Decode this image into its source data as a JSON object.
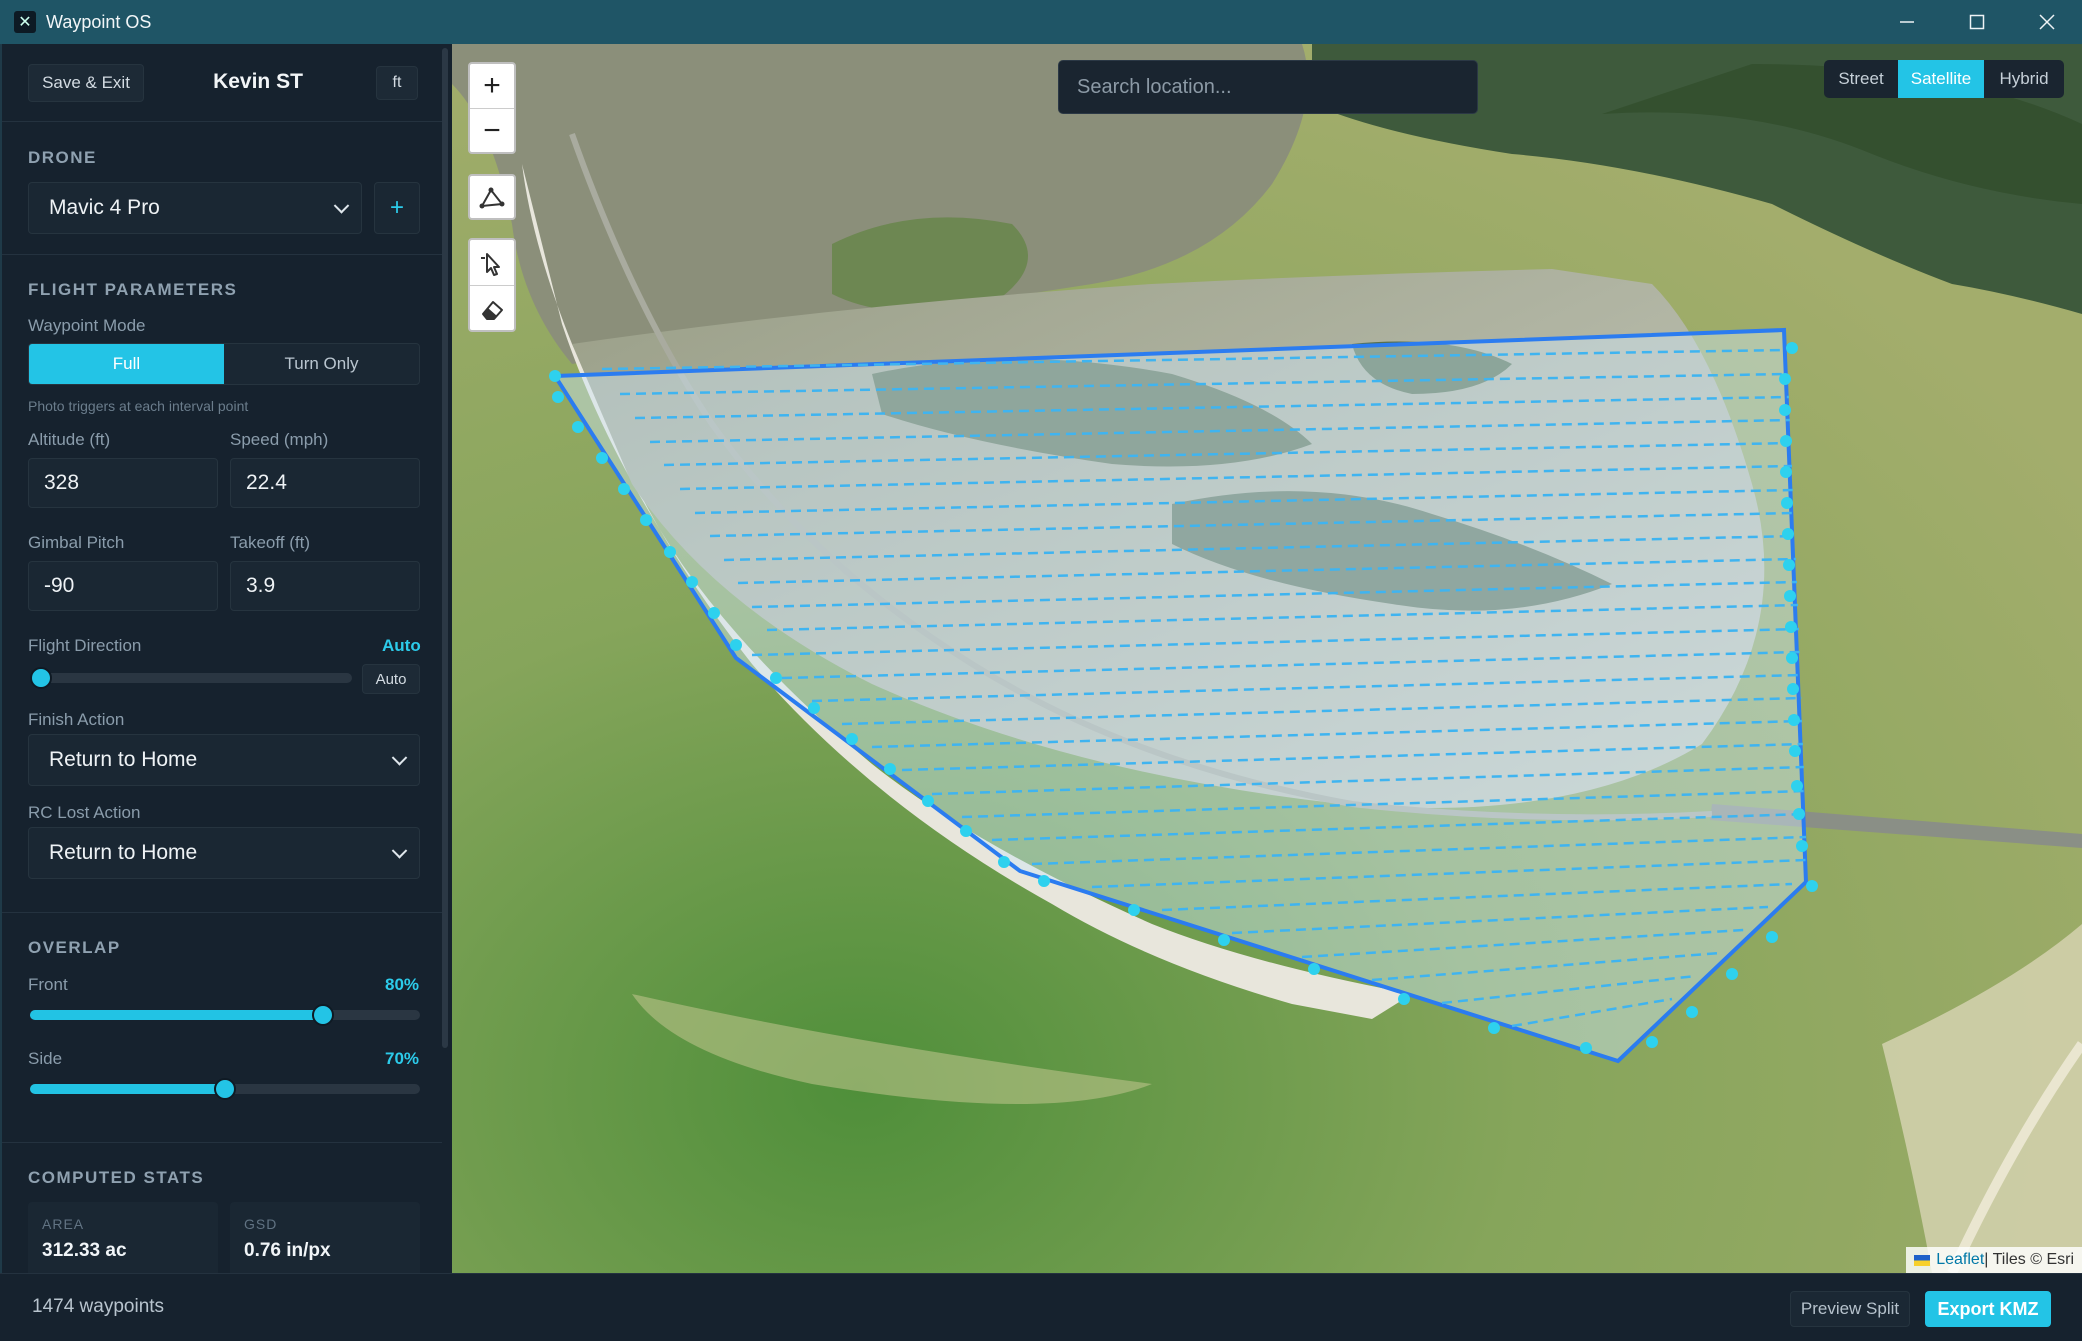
{
  "window": {
    "title": "Waypoint OS"
  },
  "header": {
    "save_exit": "Save & Exit",
    "user": "Kevin ST",
    "units": "ft"
  },
  "drone": {
    "section": "DRONE",
    "selected": "Mavic 4 Pro",
    "add": "+"
  },
  "flight": {
    "section": "FLIGHT PARAMETERS",
    "mode_label": "Waypoint Mode",
    "mode_full": "Full",
    "mode_turn": "Turn Only",
    "mode_hint": "Photo triggers at each interval point",
    "altitude_label": "Altitude (ft)",
    "altitude": "328",
    "speed_label": "Speed (mph)",
    "speed": "22.4",
    "gimbal_label": "Gimbal Pitch",
    "gimbal": "-90",
    "takeoff_label": "Takeoff (ft)",
    "takeoff": "3.9",
    "direction_label": "Flight Direction",
    "direction_value": "Auto",
    "direction_button": "Auto",
    "direction_level": 0,
    "finish_label": "Finish Action",
    "finish_value": "Return to Home",
    "rclost_label": "RC Lost Action",
    "rclost_value": "Return to Home"
  },
  "overlap": {
    "section": "OVERLAP",
    "front_label": "Front",
    "front_value": "80%",
    "front_level": 0.75,
    "side_label": "Side",
    "side_value": "70%",
    "side_level": 0.5
  },
  "stats": {
    "section": "COMPUTED STATS",
    "area_label": "AREA",
    "area_value": "312.33 ac",
    "gsd_label": "GSD",
    "gsd_value": "0.76 in/px"
  },
  "footer": {
    "waypoints": "1474 waypoints",
    "preview": "Preview Split",
    "export": "Export KMZ"
  },
  "map": {
    "search_placeholder": "Search location...",
    "zoom_in": "+",
    "zoom_out": "−",
    "layers": [
      "Street",
      "Satellite",
      "Hybrid"
    ],
    "active_layer": "Satellite",
    "attribution_link": "Leaflet",
    "attribution_text": " | Tiles © Esri",
    "colors": {
      "accent": "#23c4e6",
      "polygon": "#2b7cf0",
      "water": "#8aa057",
      "land": "#dcdcd4"
    }
  }
}
